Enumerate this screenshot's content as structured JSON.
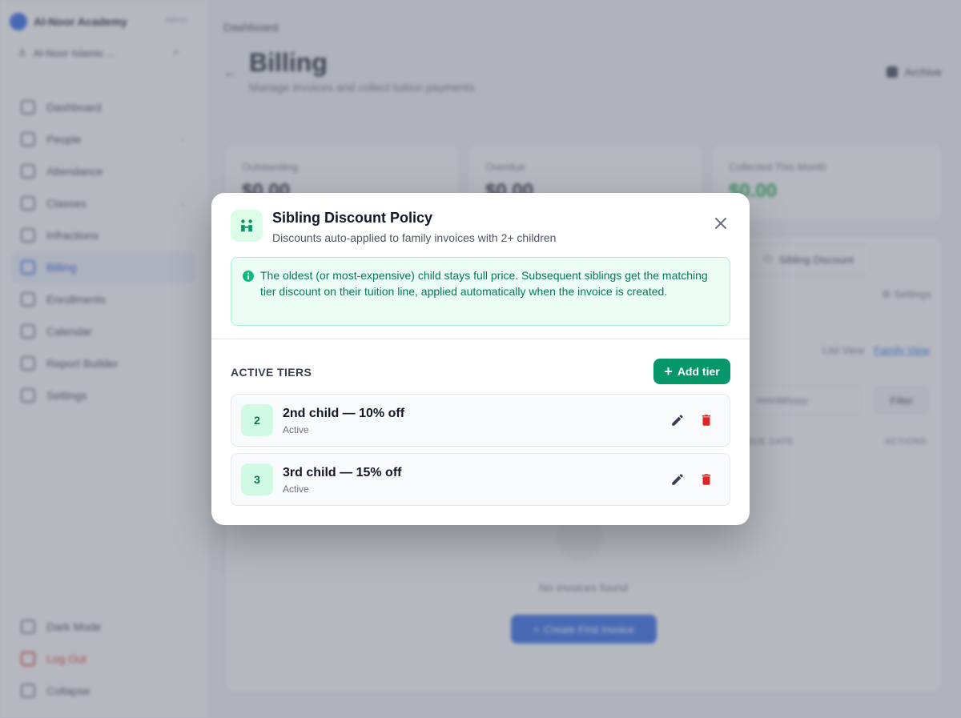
{
  "sidebar": {
    "brand": "Al-Noor Academy",
    "brand_tag": "Admin",
    "school": "Al-Noor Islamic ...",
    "items": [
      {
        "label": "Dashboard"
      },
      {
        "label": "People"
      },
      {
        "label": "Attendance"
      },
      {
        "label": "Classes"
      },
      {
        "label": "Infractions"
      },
      {
        "label": "Billing"
      },
      {
        "label": "Enrollments"
      },
      {
        "label": "Calendar"
      },
      {
        "label": "Report Builder"
      },
      {
        "label": "Settings"
      }
    ],
    "bottom": [
      {
        "label": "Dark Mode"
      },
      {
        "label": "Log Out"
      },
      {
        "label": "Collapse"
      }
    ]
  },
  "main": {
    "breadcrumb": "Dashboard",
    "title": "Billing",
    "subtitle": "Manage invoices and collect tuition payments",
    "archive_label": "Archive",
    "stats": [
      {
        "label": "Outstanding",
        "value": "$0.00"
      },
      {
        "label": "Overdue",
        "value": "$0.00"
      },
      {
        "label": "Collected This Month",
        "value": "$0.00"
      }
    ],
    "sibling_button": "Sibling Discount",
    "settings_link": "Settings",
    "view_list": "List View",
    "view_family": "Family View",
    "date_placeholder": "mm/dd/yyyy",
    "filter_label": "Filter",
    "col_due": "DUE DATE",
    "col_actions": "ACTIONS",
    "empty_text": "No invoices found",
    "create_button": "Create First Invoice"
  },
  "modal": {
    "title": "Sibling Discount Policy",
    "subtitle": "Discounts auto-applied to family invoices with 2+ children",
    "info": "The oldest (or most-expensive) child stays full price. Subsequent siblings get the matching tier discount on their tuition line, applied automatically when the invoice is created.",
    "tiers_label": "ACTIVE TIERS",
    "add_button": "Add tier",
    "tiers": [
      {
        "number": "2",
        "name": "2nd child — 10% off",
        "status": "Active"
      },
      {
        "number": "3",
        "name": "3rd child — 15% off",
        "status": "Active"
      }
    ]
  },
  "colors": {
    "accent_green": "#059669",
    "delete_red": "#dc2626",
    "info_bg": "#ecfdf5",
    "primary_blue": "#2563eb"
  },
  "icons": {
    "modal_icon": "family-icon",
    "close": "close-icon",
    "info": "info-icon",
    "edit": "pencil-icon",
    "delete": "trash-icon"
  }
}
